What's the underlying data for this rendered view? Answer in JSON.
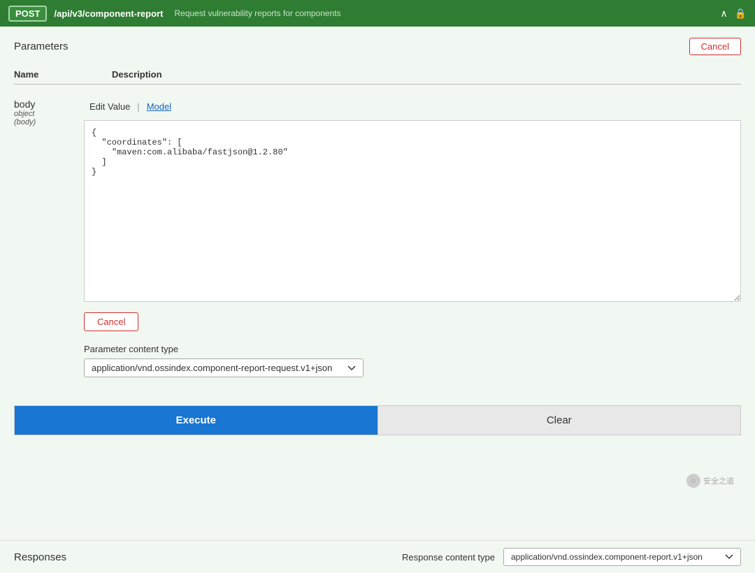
{
  "header": {
    "method": "POST",
    "endpoint": "/api/v3/component-report",
    "description": "Request vulnerability reports for components",
    "chevron_icon": "∧",
    "lock_icon": "🔒"
  },
  "parameters_section": {
    "title": "Parameters",
    "cancel_button_label": "Cancel"
  },
  "table": {
    "col_name": "Name",
    "col_description": "Description"
  },
  "param": {
    "name": "body",
    "type": "object",
    "subtype": "(body)",
    "tab_edit": "Edit Value",
    "tab_model": "Model",
    "textarea_value": "{\n  \"coordinates\": [\n    \"maven:com.alibaba/fastjson@1.2.80\"\n  ]\n}",
    "cancel_inline_label": "Cancel",
    "content_type_label": "Parameter content type",
    "content_type_value": "application/vnd.ossindex.component-report-request.v1+json",
    "content_type_options": [
      "application/vnd.ossindex.component-report-request.v1+json"
    ]
  },
  "action_bar": {
    "execute_label": "Execute",
    "clear_label": "Clear"
  },
  "responses": {
    "label": "Responses",
    "content_type_label": "Response content type",
    "content_type_value": "application/vnd.ossindex.component-report.v1+json",
    "content_type_options": [
      "application/vnd.ossindex.component-report.v1+json"
    ]
  },
  "watermark": {
    "text": "安全之道"
  }
}
